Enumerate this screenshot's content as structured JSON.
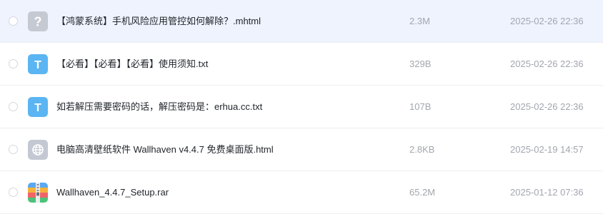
{
  "files": [
    {
      "icon": "unknown-file-icon",
      "name": "【鸿蒙系统】手机风险应用管控如何解除？.mhtml",
      "size": "2.3M",
      "date": "2025-02-26 22:36",
      "selected": true
    },
    {
      "icon": "text-file-icon",
      "name": "【必看】【必看】【必看】使用须知.txt",
      "size": "329B",
      "date": "2025-02-26 22:36",
      "selected": false
    },
    {
      "icon": "text-file-icon",
      "name": "如若解压需要密码的话，解压密码是：erhua.cc.txt",
      "size": "107B",
      "date": "2025-02-26 22:36",
      "selected": false
    },
    {
      "icon": "web-file-icon",
      "name": "电脑高清壁纸软件 Wallhaven v4.4.7 免费桌面版.html",
      "size": "2.8KB",
      "date": "2025-02-19 14:57",
      "selected": false
    },
    {
      "icon": "archive-file-icon",
      "name": "Wallhaven_4.4.7_Setup.rar",
      "size": "65.2M",
      "date": "2025-01-12 07:36",
      "selected": false
    }
  ],
  "icon_colors": {
    "unknown": "#c5c9d1",
    "text": "#5ab5f2",
    "web": "#c3c8d2"
  }
}
